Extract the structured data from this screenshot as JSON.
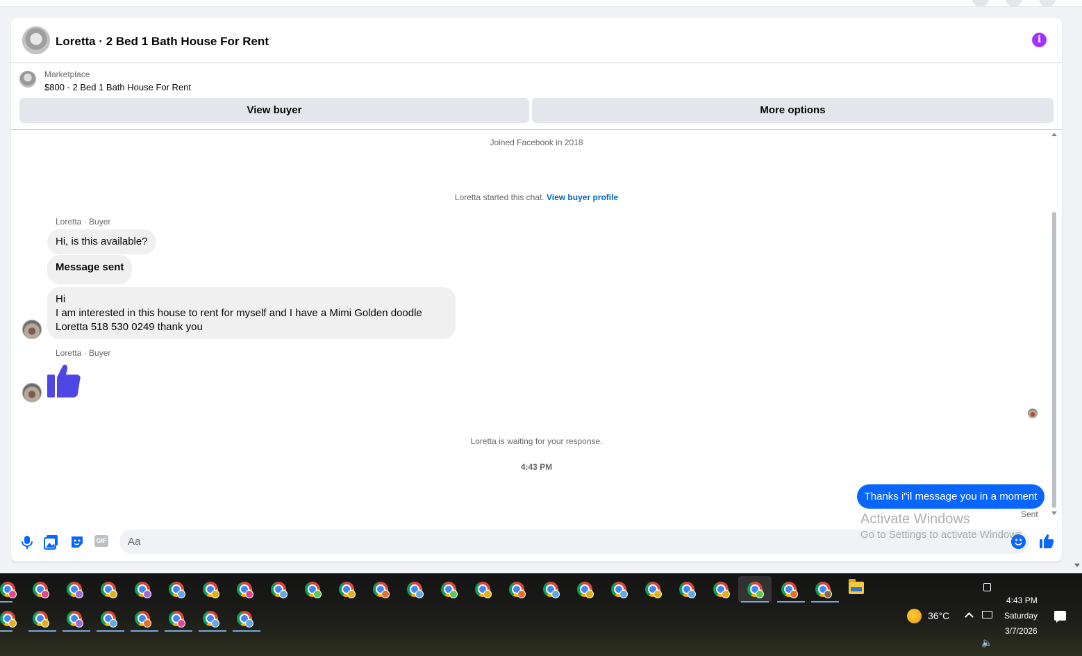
{
  "header": {
    "title": "Loretta · 2 Bed 1 Bath House For Rent",
    "info_icon": "info-icon"
  },
  "listing": {
    "category": "Marketplace",
    "title": "$800 - 2 Bed 1 Bath House For Rent"
  },
  "actions": {
    "view_buyer": "View buyer",
    "more_options": "More options"
  },
  "thread": {
    "joined": "Joined Facebook in 2018",
    "started_prefix": "Loretta started this chat.",
    "started_link": "View buyer profile",
    "sender_label": "Loretta · Buyer",
    "messages": {
      "msg1": "Hi, is this available?",
      "msg2": "Message sent",
      "msg3_lines": [
        "Hi",
        "I am interested in this house to rent for myself and I have a Mimi Golden doodle",
        "Loretta 518 530 0249 thank you"
      ]
    },
    "waiting": "Loretta is waiting for your response.",
    "timestamp": "4:43 PM",
    "outgoing": "Thanks i\"il message you in a moment",
    "outgoing_status": "Sent"
  },
  "composer": {
    "placeholder": "Aa",
    "icons": [
      "microphone-icon",
      "photo-icon",
      "sticker-icon",
      "gif-icon",
      "emoji-icon",
      "like-icon"
    ],
    "gif_label": "GIF"
  },
  "watermark": {
    "title": "Activate Windows",
    "subtitle": "Go to Settings to activate Windows."
  },
  "taskbar": {
    "weather_temp": "36°C",
    "time": "4:43 PM",
    "day": "Saturday",
    "date": "3/7/2026"
  },
  "colors": {
    "accent": "#0866ff",
    "info": "#a033ff",
    "like_thumb": "#4e46e5"
  }
}
